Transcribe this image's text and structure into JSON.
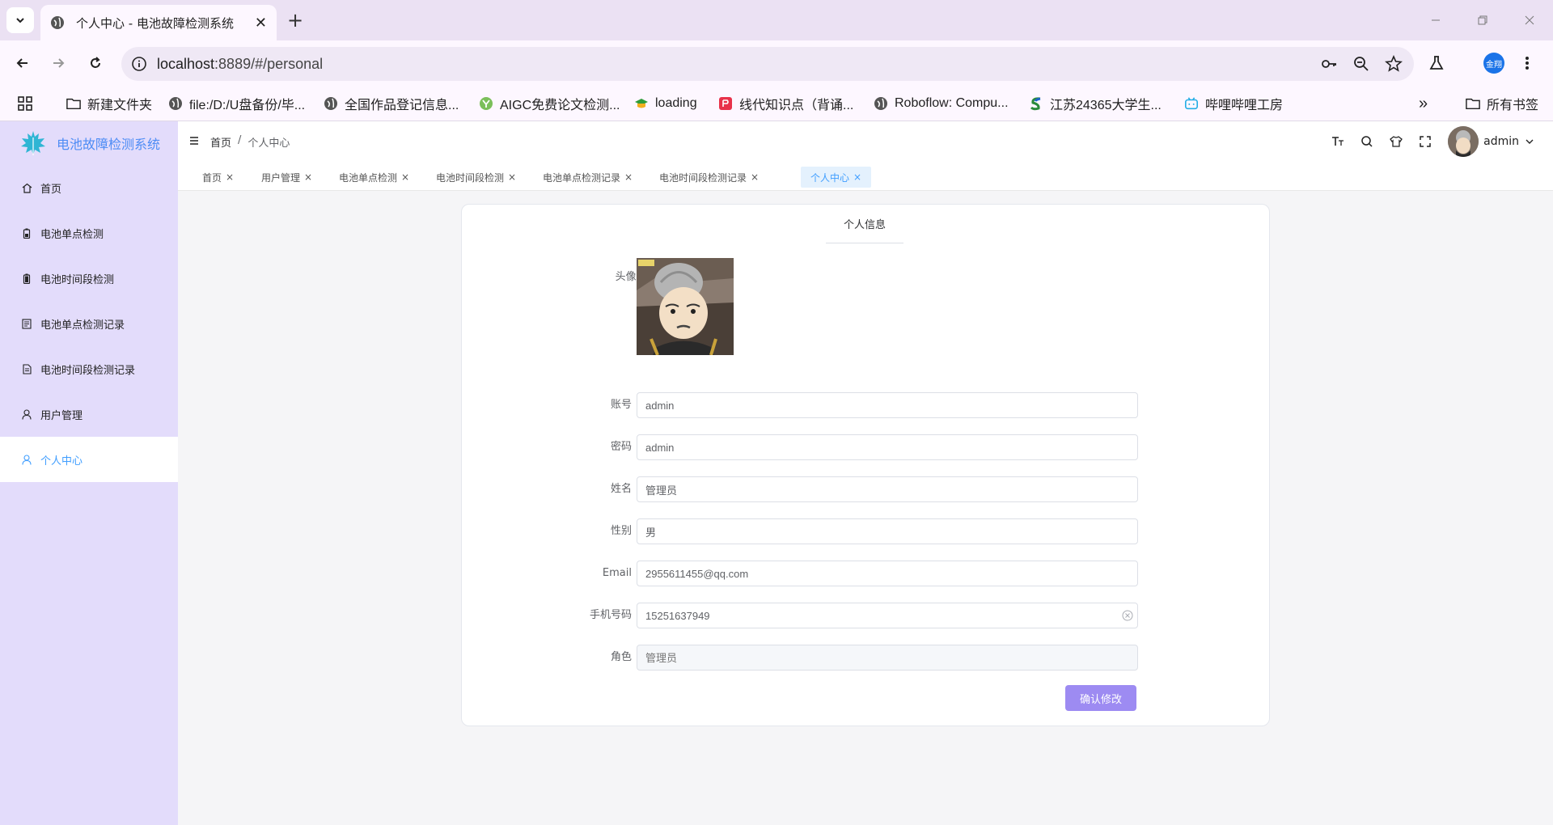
{
  "browser": {
    "tab_title": "个人中心 - 电池故障检测系统",
    "tab_close": "✕",
    "new_tab": "+",
    "url_host": "localhost",
    "url_rest": ":8889/#/personal",
    "profile_label": "金翔",
    "bookmarks": [
      {
        "label": "新建文件夹",
        "icon": "folder-icon"
      },
      {
        "label": "file:/D:/U盘备份/毕...",
        "icon": "globe-icon"
      },
      {
        "label": "全国作品登记信息...",
        "icon": "globe-icon"
      },
      {
        "label": "AIGC免费论文检测...",
        "icon": "y-logo-icon"
      },
      {
        "label": "loading",
        "icon": "graduation-cap-icon"
      },
      {
        "label": "线代知识点（背诵...",
        "icon": "red-app-icon"
      },
      {
        "label": "Roboflow: Compu...",
        "icon": "globe-icon"
      },
      {
        "label": "江苏24365大学生...",
        "icon": "s-logo-icon"
      },
      {
        "label": "哔哩哔哩工房",
        "icon": "bilibili-icon"
      }
    ],
    "more_bookmarks": "»",
    "all_bookmarks": "所有书签"
  },
  "app": {
    "system_name": "电池故障检测系统",
    "menu": [
      {
        "label": "首页",
        "icon": "home-icon"
      },
      {
        "label": "电池单点检测",
        "icon": "battery-icon"
      },
      {
        "label": "电池时间段检测",
        "icon": "battery-full-icon"
      },
      {
        "label": "电池单点检测记录",
        "icon": "document-icon"
      },
      {
        "label": "电池时间段检测记录",
        "icon": "tickets-icon"
      },
      {
        "label": "用户管理",
        "icon": "user-icon"
      },
      {
        "label": "个人中心",
        "icon": "user-icon"
      }
    ],
    "active_menu": "个人中心",
    "breadcrumb": {
      "home": "首页",
      "sep": "/",
      "current": "个人中心"
    },
    "username": "admin",
    "tags": [
      {
        "label": "首页"
      },
      {
        "label": "用户管理"
      },
      {
        "label": "电池单点检测"
      },
      {
        "label": "电池时间段检测"
      },
      {
        "label": "电池单点检测记录"
      },
      {
        "label": "电池时间段检测记录"
      },
      {
        "label": "个人中心"
      }
    ],
    "tag_close": "×",
    "colors": {
      "accent": "#409eff",
      "sidebar": "#e3dcfb",
      "button": "#9d8bf2"
    }
  },
  "profile_card": {
    "title": "个人信息",
    "avatar_label": "头像:",
    "fields": {
      "account": {
        "label": "账号",
        "value": "admin"
      },
      "password": {
        "label": "密码",
        "value": "admin"
      },
      "name": {
        "label": "姓名",
        "value": "管理员"
      },
      "gender": {
        "label": "性别",
        "value": "男"
      },
      "email": {
        "label": "Email",
        "value": "2955611455@qq.com"
      },
      "phone": {
        "label": "手机号码",
        "value": "15251637949"
      },
      "role": {
        "label": "角色",
        "placeholder": "管理员"
      }
    },
    "confirm_button": "确认修改"
  }
}
